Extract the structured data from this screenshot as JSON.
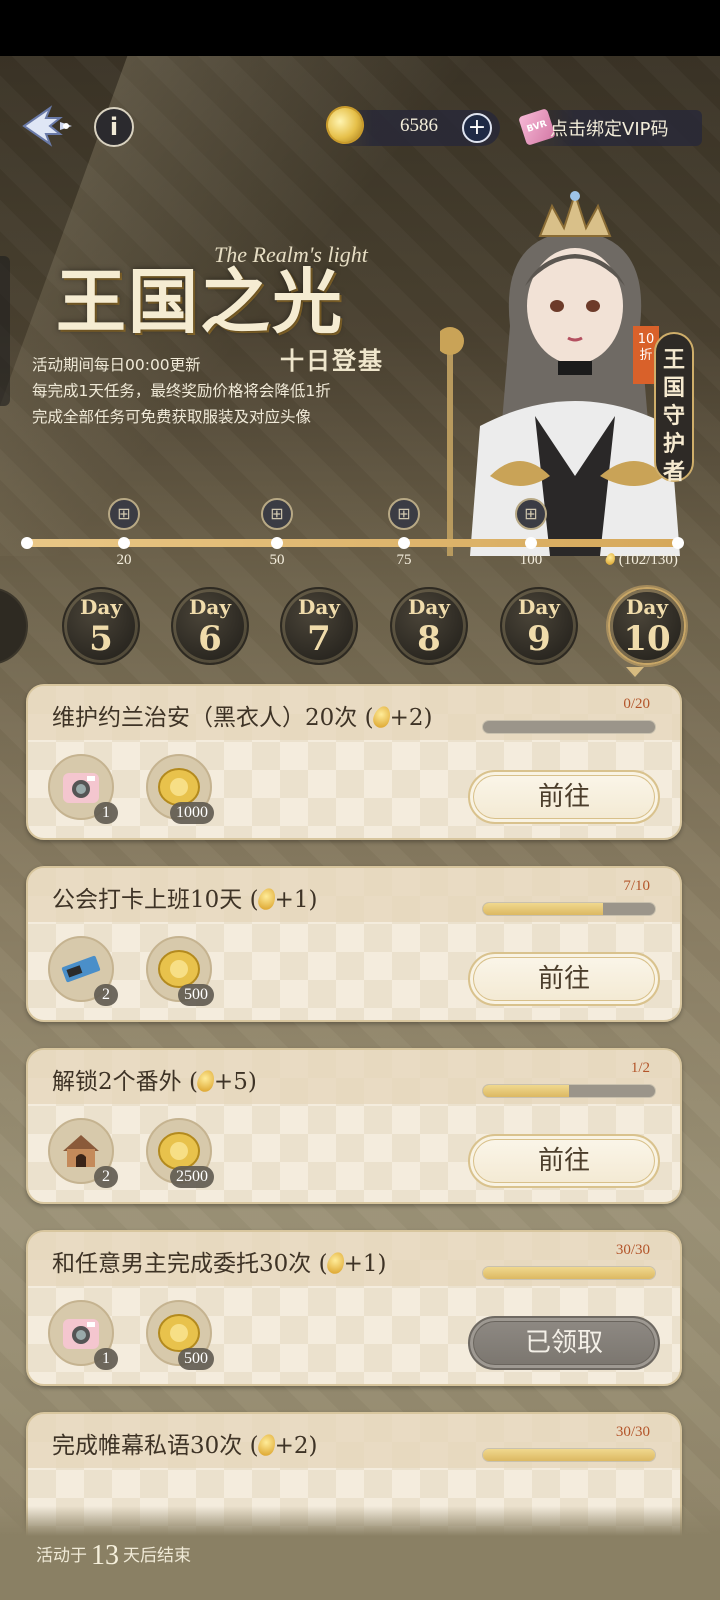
{
  "header": {
    "currency_value": "6586",
    "currency_plus": "+",
    "vip_label": "点击绑定VIP码",
    "vip_icon_text": "BVR",
    "info_label": "i"
  },
  "banner": {
    "title": "王国之光",
    "title_en": "The Realm's light",
    "subtitle": "十日登基",
    "desc_lines": [
      "活动期间每日00:00更新",
      "每完成1天任务，最终奖励价格将会降低1折",
      "完成全部任务可免费获取服装及对应头像"
    ],
    "discount_badge": "10折",
    "guardian_badge": "王国守护者"
  },
  "milestones": {
    "ticks": [
      "20",
      "50",
      "75",
      "100"
    ],
    "progress_label": "(102/130)",
    "progress_fraction": 1.0
  },
  "days": [
    {
      "label": "Day",
      "num": "5"
    },
    {
      "label": "Day",
      "num": "6"
    },
    {
      "label": "Day",
      "num": "7"
    },
    {
      "label": "Day",
      "num": "8"
    },
    {
      "label": "Day",
      "num": "9"
    },
    {
      "label": "Day",
      "num": "10"
    }
  ],
  "tasks": [
    {
      "title": "维护约兰治安（黑衣人）20次 (",
      "bonus": "+2)",
      "progress": "0/20",
      "fill": 0.0,
      "rewards": [
        {
          "icon": "instant-camera-icon",
          "qty": "1"
        },
        {
          "icon": "gold-coin-icon",
          "qty": "1000"
        }
      ],
      "button": "前往"
    },
    {
      "title": "公会打卡上班10天 (",
      "bonus": "+1)",
      "progress": "7/10",
      "fill": 0.7,
      "rewards": [
        {
          "icon": "chocolate-bar-icon",
          "qty": "2"
        },
        {
          "icon": "gold-coin-icon",
          "qty": "500"
        }
      ],
      "button": "前往"
    },
    {
      "title": "解锁2个番外 (",
      "bonus": "+5)",
      "progress": "1/2",
      "fill": 0.5,
      "rewards": [
        {
          "icon": "dog-house-icon",
          "qty": "2"
        },
        {
          "icon": "gold-coin-icon",
          "qty": "2500"
        }
      ],
      "button": "前往"
    },
    {
      "title": "和任意男主完成委托30次 (",
      "bonus": "+1)",
      "progress": "30/30",
      "fill": 1.0,
      "rewards": [
        {
          "icon": "instant-camera-icon",
          "qty": "1"
        },
        {
          "icon": "gold-coin-icon",
          "qty": "500"
        }
      ],
      "button": "已领取"
    },
    {
      "title": "完成帷幕私语30次 (",
      "bonus": "+2)",
      "progress": "30/30",
      "fill": 1.0
    }
  ],
  "footer": {
    "prefix": "活动于",
    "days_left": "13",
    "suffix": "天后结束"
  },
  "colors": {
    "accent_gold": "#d6a85a",
    "progress_text": "#b3552a",
    "claimed_button": "#8f8a84"
  }
}
